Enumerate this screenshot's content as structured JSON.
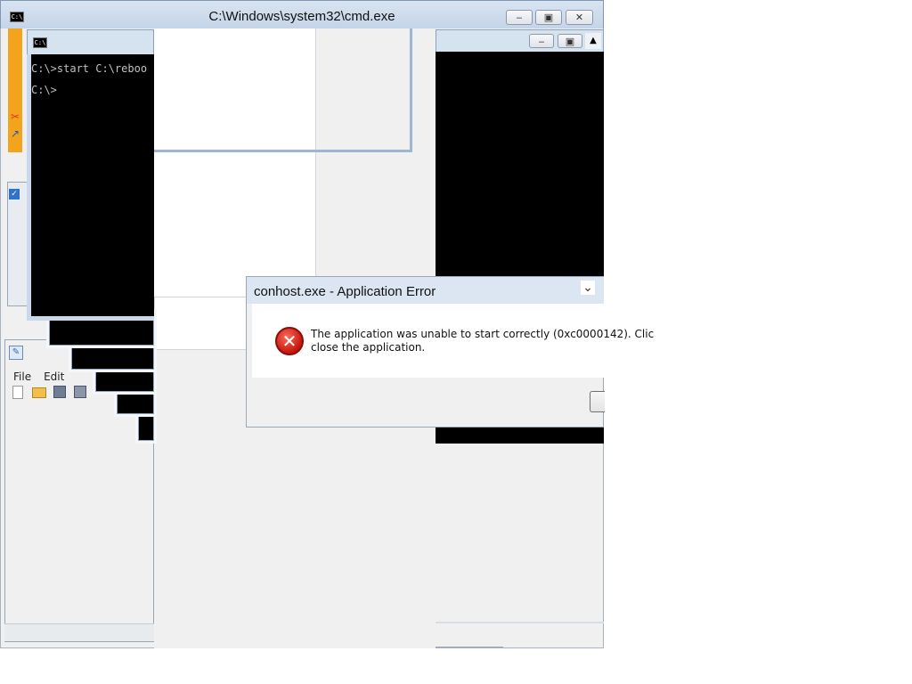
{
  "cmd_window": {
    "title": "C:\\Windows\\system32\\cmd.exe",
    "icon_text": "C:\\",
    "lines": [
      "C:\\>start C:\\reboo",
      "C:\\>"
    ],
    "min_glyph": "▭",
    "max_glyph": "▣",
    "close_glyph": "✕"
  },
  "error_dialog": {
    "title": "conhost.exe - Application Error",
    "message_line1": "The application was unable to start correctly (0xc0000142). Clic",
    "message_line2": "close the application.",
    "icon": "error-x-icon",
    "icon_glyph": "✕",
    "scroll_glyph": "⌄"
  },
  "notepad": {
    "menu": [
      "File",
      "Edit"
    ]
  },
  "colors": {
    "error_red": "#c4160e",
    "accent_orange": "#f4a41c",
    "console_bg": "#000000"
  }
}
